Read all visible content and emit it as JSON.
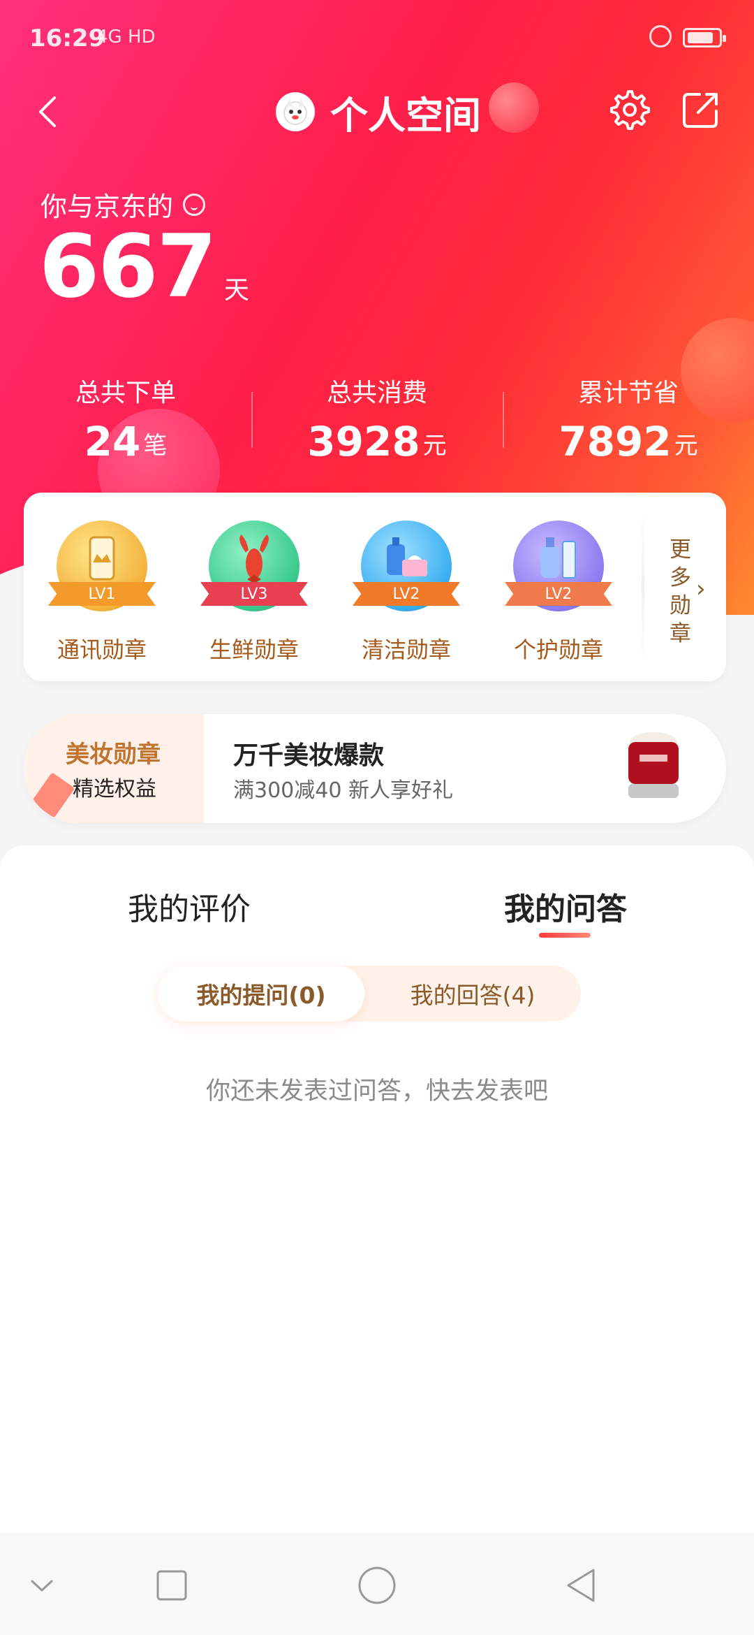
{
  "status": {
    "time": "16:29",
    "network": "4G HD"
  },
  "header": {
    "title": "个人空间"
  },
  "relation": {
    "label": "你与京东的",
    "days": "667",
    "days_unit": "天"
  },
  "stats": [
    {
      "label": "总共下单",
      "value": "24",
      "unit": "笔"
    },
    {
      "label": "总共消费",
      "value": "3928",
      "unit": "元"
    },
    {
      "label": "累计节省",
      "value": "7892",
      "unit": "元"
    }
  ],
  "badges": [
    {
      "name": "通讯勋章",
      "level": "LV1",
      "color": "#f3b33d",
      "icon": "phone-crown-icon"
    },
    {
      "name": "生鲜勋章",
      "level": "LV3",
      "color": "#38c98d",
      "icon": "lobster-icon"
    },
    {
      "name": "清洁勋章",
      "level": "LV2",
      "color": "#3aaef0",
      "icon": "cleaning-icon"
    },
    {
      "name": "个护勋章",
      "level": "LV2",
      "color": "#8b7cf0",
      "icon": "personal-care-icon"
    }
  ],
  "more_badges": "更多勋章",
  "promo": {
    "badge_title": "美妆勋章",
    "badge_sub": "精选权益",
    "title": "万千美妆爆款",
    "subtitle": "满300减40  新人享好礼"
  },
  "tabs": [
    "我的评价",
    "我的问答"
  ],
  "segment": [
    "我的提问(0)",
    "我的回答(4)"
  ],
  "empty_message": "你还未发表过问答，快去发表吧",
  "colors": {
    "accent": "#ff1f4a",
    "gold_text": "#a55a1a"
  }
}
